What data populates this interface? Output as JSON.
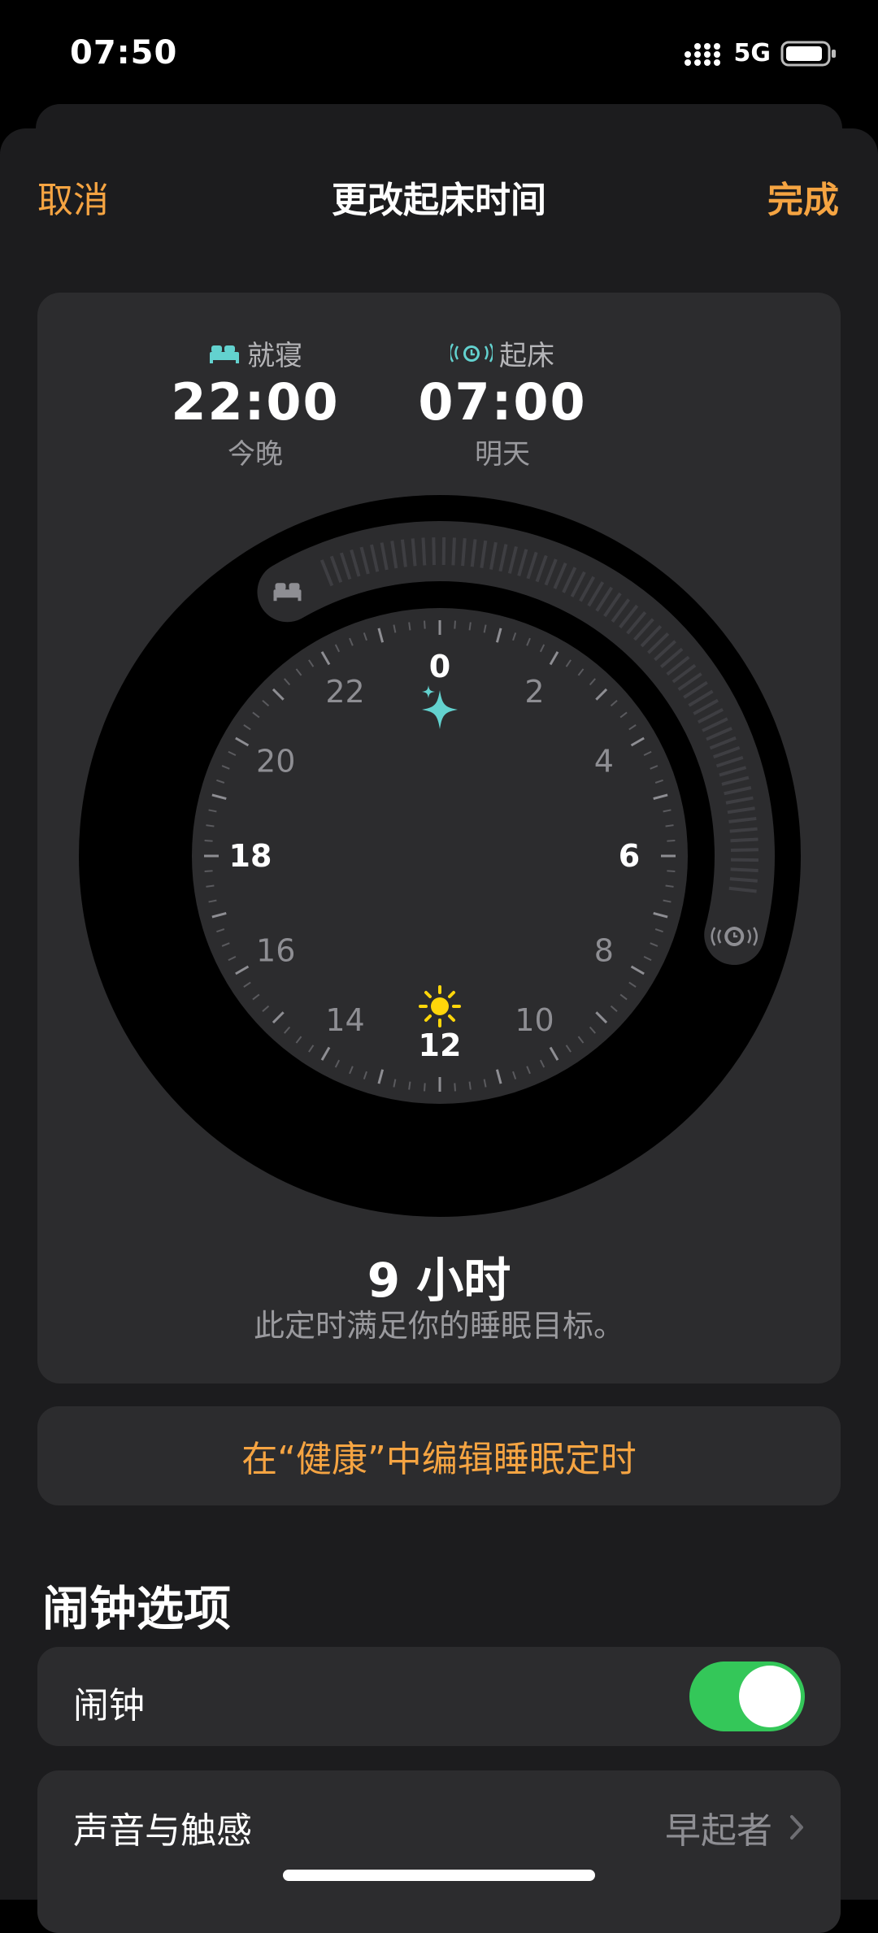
{
  "status_bar": {
    "time": "07:50",
    "network": "5G"
  },
  "nav": {
    "cancel": "取消",
    "title": "更改起床时间",
    "done": "完成"
  },
  "schedule": {
    "bedtime": {
      "label": "就寝",
      "time": "22:00",
      "day": "今晚"
    },
    "wake": {
      "label": "起床",
      "time": "07:00",
      "day": "明天"
    },
    "clock_numbers": [
      "0",
      "2",
      "4",
      "6",
      "8",
      "10",
      "12",
      "14",
      "16",
      "18",
      "20",
      "22"
    ],
    "duration": "9 小时",
    "goal_text": "此定时满足你的睡眠目标。"
  },
  "edit_in_health": "在“健康”中编辑睡眠定时",
  "alarm_options": {
    "title": "闹钟选项",
    "alarm_label": "闹钟",
    "alarm_enabled": true,
    "sound_label": "声音与触感",
    "sound_value": "早起者"
  },
  "colors": {
    "accent": "#f5a442",
    "toggle_on": "#34c759",
    "bed_icon": "#63d2cf",
    "sun_icon": "#ffd60a"
  }
}
